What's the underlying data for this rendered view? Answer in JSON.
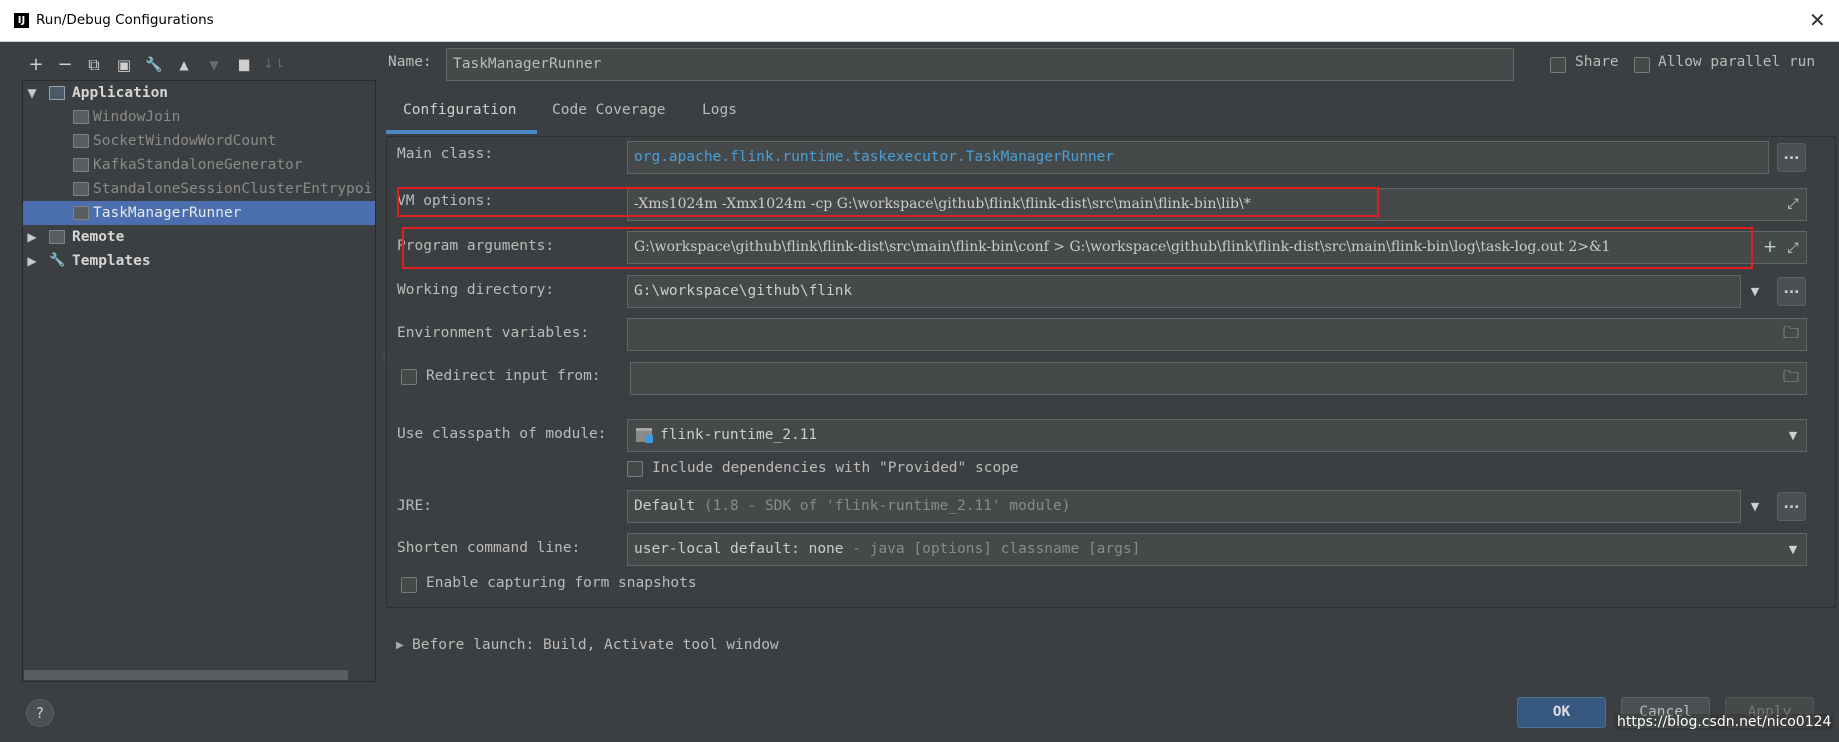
{
  "window": {
    "title": "Run/Debug Configurations",
    "app_icon_text": "IJ",
    "close_glyph": "✕"
  },
  "toolbar": {
    "icons": [
      "add-icon",
      "remove-icon",
      "copy-icon",
      "save-icon",
      "wrench-icon",
      "arrow-up-icon",
      "arrow-down-icon",
      "folder-add-icon",
      "sort-icon"
    ],
    "glyphs": {
      "add": "+",
      "remove": "−",
      "copy": "⧉",
      "save": "▣",
      "wrench": "🔧",
      "up": "▲",
      "down": "▼",
      "folder": "▆",
      "sort": "↓⇂"
    }
  },
  "tree": {
    "application": "Application",
    "items": [
      "WindowJoin",
      "SocketWindowWordCount",
      "KafkaStandaloneGenerator",
      "StandaloneSessionClusterEntrypoi",
      "TaskManagerRunner"
    ],
    "remote": "Remote",
    "templates": "Templates"
  },
  "header": {
    "name_label": "Name:",
    "name_value": "TaskManagerRunner",
    "share_label": "Share",
    "parallel_label": "Allow parallel run"
  },
  "tabs": [
    "Configuration",
    "Code Coverage",
    "Logs"
  ],
  "form": {
    "main_class_label": "Main class:",
    "main_class_value": "org.apache.flink.runtime.taskexecutor.TaskManagerRunner",
    "vm_options_label": "VM options:",
    "vm_options_value": "-Xms1024m -Xmx1024m -cp G:\\workspace\\github\\flink\\flink-dist\\src\\main\\flink-bin\\lib\\*",
    "program_args_label": "Program arguments:",
    "program_args_value": "G:\\workspace\\github\\flink\\flink-dist\\src\\main\\flink-bin\\conf > G:\\workspace\\github\\flink\\flink-dist\\src\\main\\flink-bin\\log\\task-log.out 2>&1",
    "working_dir_label": "Working directory:",
    "working_dir_value": "G:\\workspace\\github\\flink",
    "env_vars_label": "Environment variables:",
    "redirect_label": "Redirect input from:",
    "classpath_label": "Use classpath of module:",
    "classpath_value": "flink-runtime_2.11",
    "include_deps_label": "Include dependencies with \"Provided\" scope",
    "jre_label": "JRE:",
    "jre_value_main": "Default",
    "jre_value_hint": "(1.8 - SDK of 'flink-runtime_2.11' module)",
    "shorten_label": "Shorten command line:",
    "shorten_value_main": "user-local default: none",
    "shorten_value_hint": "- java [options] classname [args]",
    "capture_label": "Enable capturing form snapshots",
    "before_launch": "Before launch: Build, Activate tool window",
    "ellipsis": "...",
    "dropdown_glyph": "▼",
    "expand_glyph": "⤢",
    "plus_glyph": "+",
    "folder_glyph": "🗀"
  },
  "footer": {
    "ok": "OK",
    "cancel": "Cancel",
    "apply": "Apply",
    "help": "?",
    "watermark": "https://blog.csdn.net/nico0124"
  },
  "colors": {
    "background": "#3c3f41",
    "selection": "#4b6eaf",
    "link": "#4a9fd6",
    "annotation_red": "#e02020",
    "ok_button": "#365880"
  }
}
